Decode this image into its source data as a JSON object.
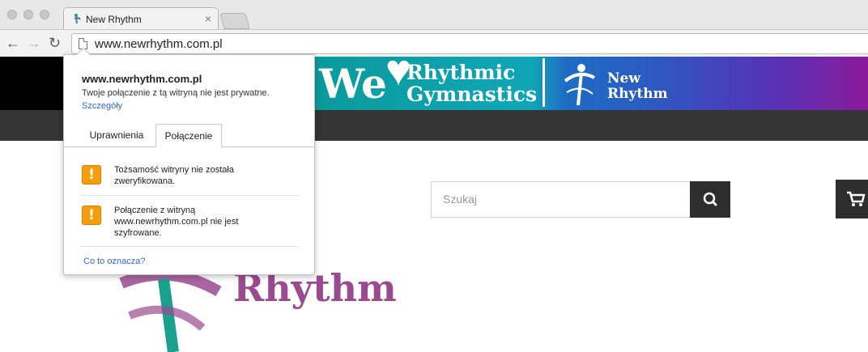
{
  "browser": {
    "tab": {
      "title": "New Rhythm",
      "close": "×"
    },
    "nav": {
      "back": "←",
      "forward": "→",
      "reload": "↻"
    },
    "url": "www.newrhythm.com.pl"
  },
  "banner": {
    "we": "We",
    "line1": "Rhythmic",
    "line2": "Gymnastics",
    "brand_line1": "New",
    "brand_line2": "Rhythm"
  },
  "search": {
    "placeholder": "Szukaj"
  },
  "logo": {
    "word": "Rhythm"
  },
  "popup": {
    "host": "www.newrhythm.com.pl",
    "message": "Twoje połączenie z tą witryną nie jest prywatne.",
    "details_link": "Szczegóły",
    "tabs": [
      "Uprawnienia",
      "Połączenie"
    ],
    "active_tab": "Połączenie",
    "warnings": [
      {
        "icon": "!",
        "line1": "Tożsamość witryny nie została",
        "line2": "zweryfikowana.",
        "line3": ""
      },
      {
        "icon": "!",
        "line1": "Połączenie z witryną",
        "line2": "www.newrhythm.com.pl nie jest",
        "line3": "szyfrowane."
      }
    ],
    "help_link": "Co to oznacza?"
  },
  "colors": {
    "warning": "#f59e0b",
    "link": "#3367d6",
    "logo": "#9a4a90",
    "navbar": "#353535"
  }
}
